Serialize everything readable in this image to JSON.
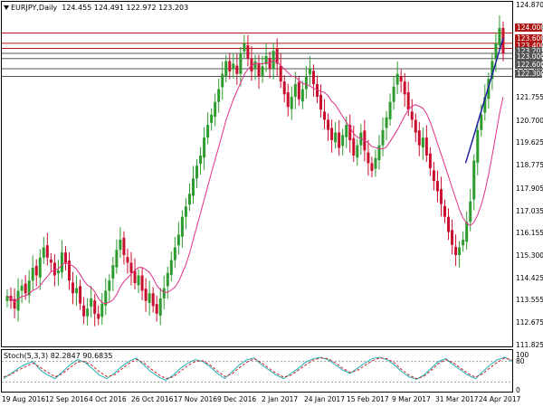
{
  "header": {
    "symbol": "EURJPY,Daily",
    "ohlc": "124.455 124.491 122.972 123.203"
  },
  "stoch_header": "Stoch(5,3,3) 82.2847 90.6835",
  "colors": {
    "bull": "#2e9b2e",
    "bear": "#c8102e",
    "ma": "#e0308a",
    "hline_red": "#b01818",
    "hline_gray": "#555555",
    "trend": "#2020a0",
    "stoch_main": "#20b0b8",
    "stoch_signal": "#c82020"
  },
  "price_axis": [
    "124.870",
    "124.000",
    "123.600",
    "123.400",
    "123.000",
    "122.600",
    "122.300",
    "121.755",
    "120.700",
    "119.625",
    "118.775",
    "117.905",
    "117.035",
    "116.155",
    "115.300",
    "114.425",
    "113.555",
    "112.675",
    "111.825"
  ],
  "price_tags": [
    {
      "text": "124.000",
      "color": "#b01818"
    },
    {
      "text": "123.600",
      "color": "#b01818"
    },
    {
      "text": "123.400",
      "color": "#b01818"
    },
    {
      "text": "123.203",
      "color": "#555555"
    },
    {
      "text": "123.000",
      "color": "#555555"
    },
    {
      "text": "122.600",
      "color": "#555555"
    },
    {
      "text": "122.300",
      "color": "#555555"
    }
  ],
  "stoch_axis": [
    "100",
    "80",
    "0"
  ],
  "date_axis": [
    "19 Aug 2016",
    "12 Sep 2016",
    "4 Oct 2016",
    "26 Oct 2016",
    "17 Nov 2016",
    "9 Dec 2016",
    "2 Jan 2017",
    "24 Jan 2017",
    "15 Feb 2017",
    "9 Mar 2017",
    "31 Mar 2017",
    "24 Apr 2017"
  ],
  "chart_data": {
    "type": "candlestick",
    "ylim": [
      111.825,
      124.87
    ],
    "ma_period": 10,
    "horizontal_levels": [
      124.0,
      123.6,
      123.4,
      123.203,
      123.0,
      122.6,
      122.3
    ],
    "trendline": [
      [
        118.9,
        183
      ],
      [
        123.8,
        198
      ]
    ],
    "closes": [
      113.7,
      113.5,
      113.2,
      113.9,
      114.1,
      113.8,
      114.3,
      114.8,
      114.5,
      115.2,
      115.6,
      115.2,
      115.0,
      114.5,
      114.7,
      115.4,
      115.0,
      114.3,
      113.8,
      114.0,
      113.4,
      112.9,
      113.2,
      113.6,
      113.0,
      112.8,
      113.4,
      113.9,
      114.3,
      114.9,
      115.5,
      115.9,
      115.3,
      115.0,
      114.6,
      114.2,
      114.5,
      113.9,
      113.5,
      113.8,
      113.3,
      113.0,
      113.6,
      114.0,
      114.6,
      115.1,
      115.6,
      116.1,
      116.8,
      117.2,
      117.7,
      118.3,
      118.8,
      119.2,
      119.9,
      120.4,
      120.8,
      121.3,
      121.8,
      122.4,
      122.9,
      122.5,
      122.8,
      122.4,
      123.2,
      123.6,
      123.0,
      122.5,
      122.9,
      122.3,
      122.7,
      123.1,
      122.6,
      123.3,
      122.8,
      122.1,
      121.6,
      121.1,
      121.5,
      122.0,
      121.4,
      121.8,
      122.3,
      122.6,
      122.0,
      121.5,
      121.0,
      120.6,
      120.2,
      119.8,
      120.1,
      119.5,
      120.0,
      120.4,
      119.8,
      119.2,
      119.6,
      120.1,
      119.4,
      118.9,
      118.6,
      119.1,
      119.6,
      120.2,
      120.7,
      121.3,
      121.9,
      122.4,
      122.1,
      121.6,
      121.0,
      120.6,
      120.1,
      119.6,
      119.9,
      119.2,
      118.7,
      118.2,
      117.8,
      117.3,
      116.8,
      116.2,
      115.7,
      115.3,
      115.6,
      115.9,
      116.6,
      117.4,
      119.0,
      120.2,
      120.8,
      121.5,
      122.2,
      122.9,
      123.6,
      124.2,
      123.2
    ],
    "stoch_main": [
      30,
      45,
      60,
      72,
      80,
      55,
      40,
      30,
      50,
      70,
      85,
      78,
      60,
      40,
      30,
      45,
      65,
      80,
      90,
      70,
      50,
      35,
      25,
      40,
      60,
      75,
      85,
      80,
      65,
      45,
      30,
      50,
      70,
      85,
      90,
      70,
      55,
      40,
      30,
      45,
      60,
      78,
      88,
      92,
      85,
      70,
      55,
      45,
      60,
      75,
      88,
      92,
      85,
      70,
      50,
      35,
      28,
      40,
      60,
      80,
      88,
      70,
      55,
      40,
      30,
      50,
      70,
      85,
      92,
      80
    ],
    "stoch_signal": [
      35,
      42,
      55,
      65,
      75,
      62,
      48,
      35,
      45,
      62,
      78,
      80,
      68,
      50,
      36,
      40,
      58,
      74,
      86,
      76,
      58,
      42,
      30,
      35,
      52,
      68,
      80,
      82,
      70,
      52,
      36,
      44,
      62,
      78,
      88,
      76,
      60,
      45,
      34,
      40,
      55,
      70,
      84,
      90,
      88,
      76,
      60,
      48,
      54,
      68,
      82,
      90,
      88,
      76,
      56,
      40,
      30,
      36,
      54,
      74,
      85,
      76,
      60,
      45,
      34,
      44,
      62,
      78,
      90,
      84
    ]
  }
}
